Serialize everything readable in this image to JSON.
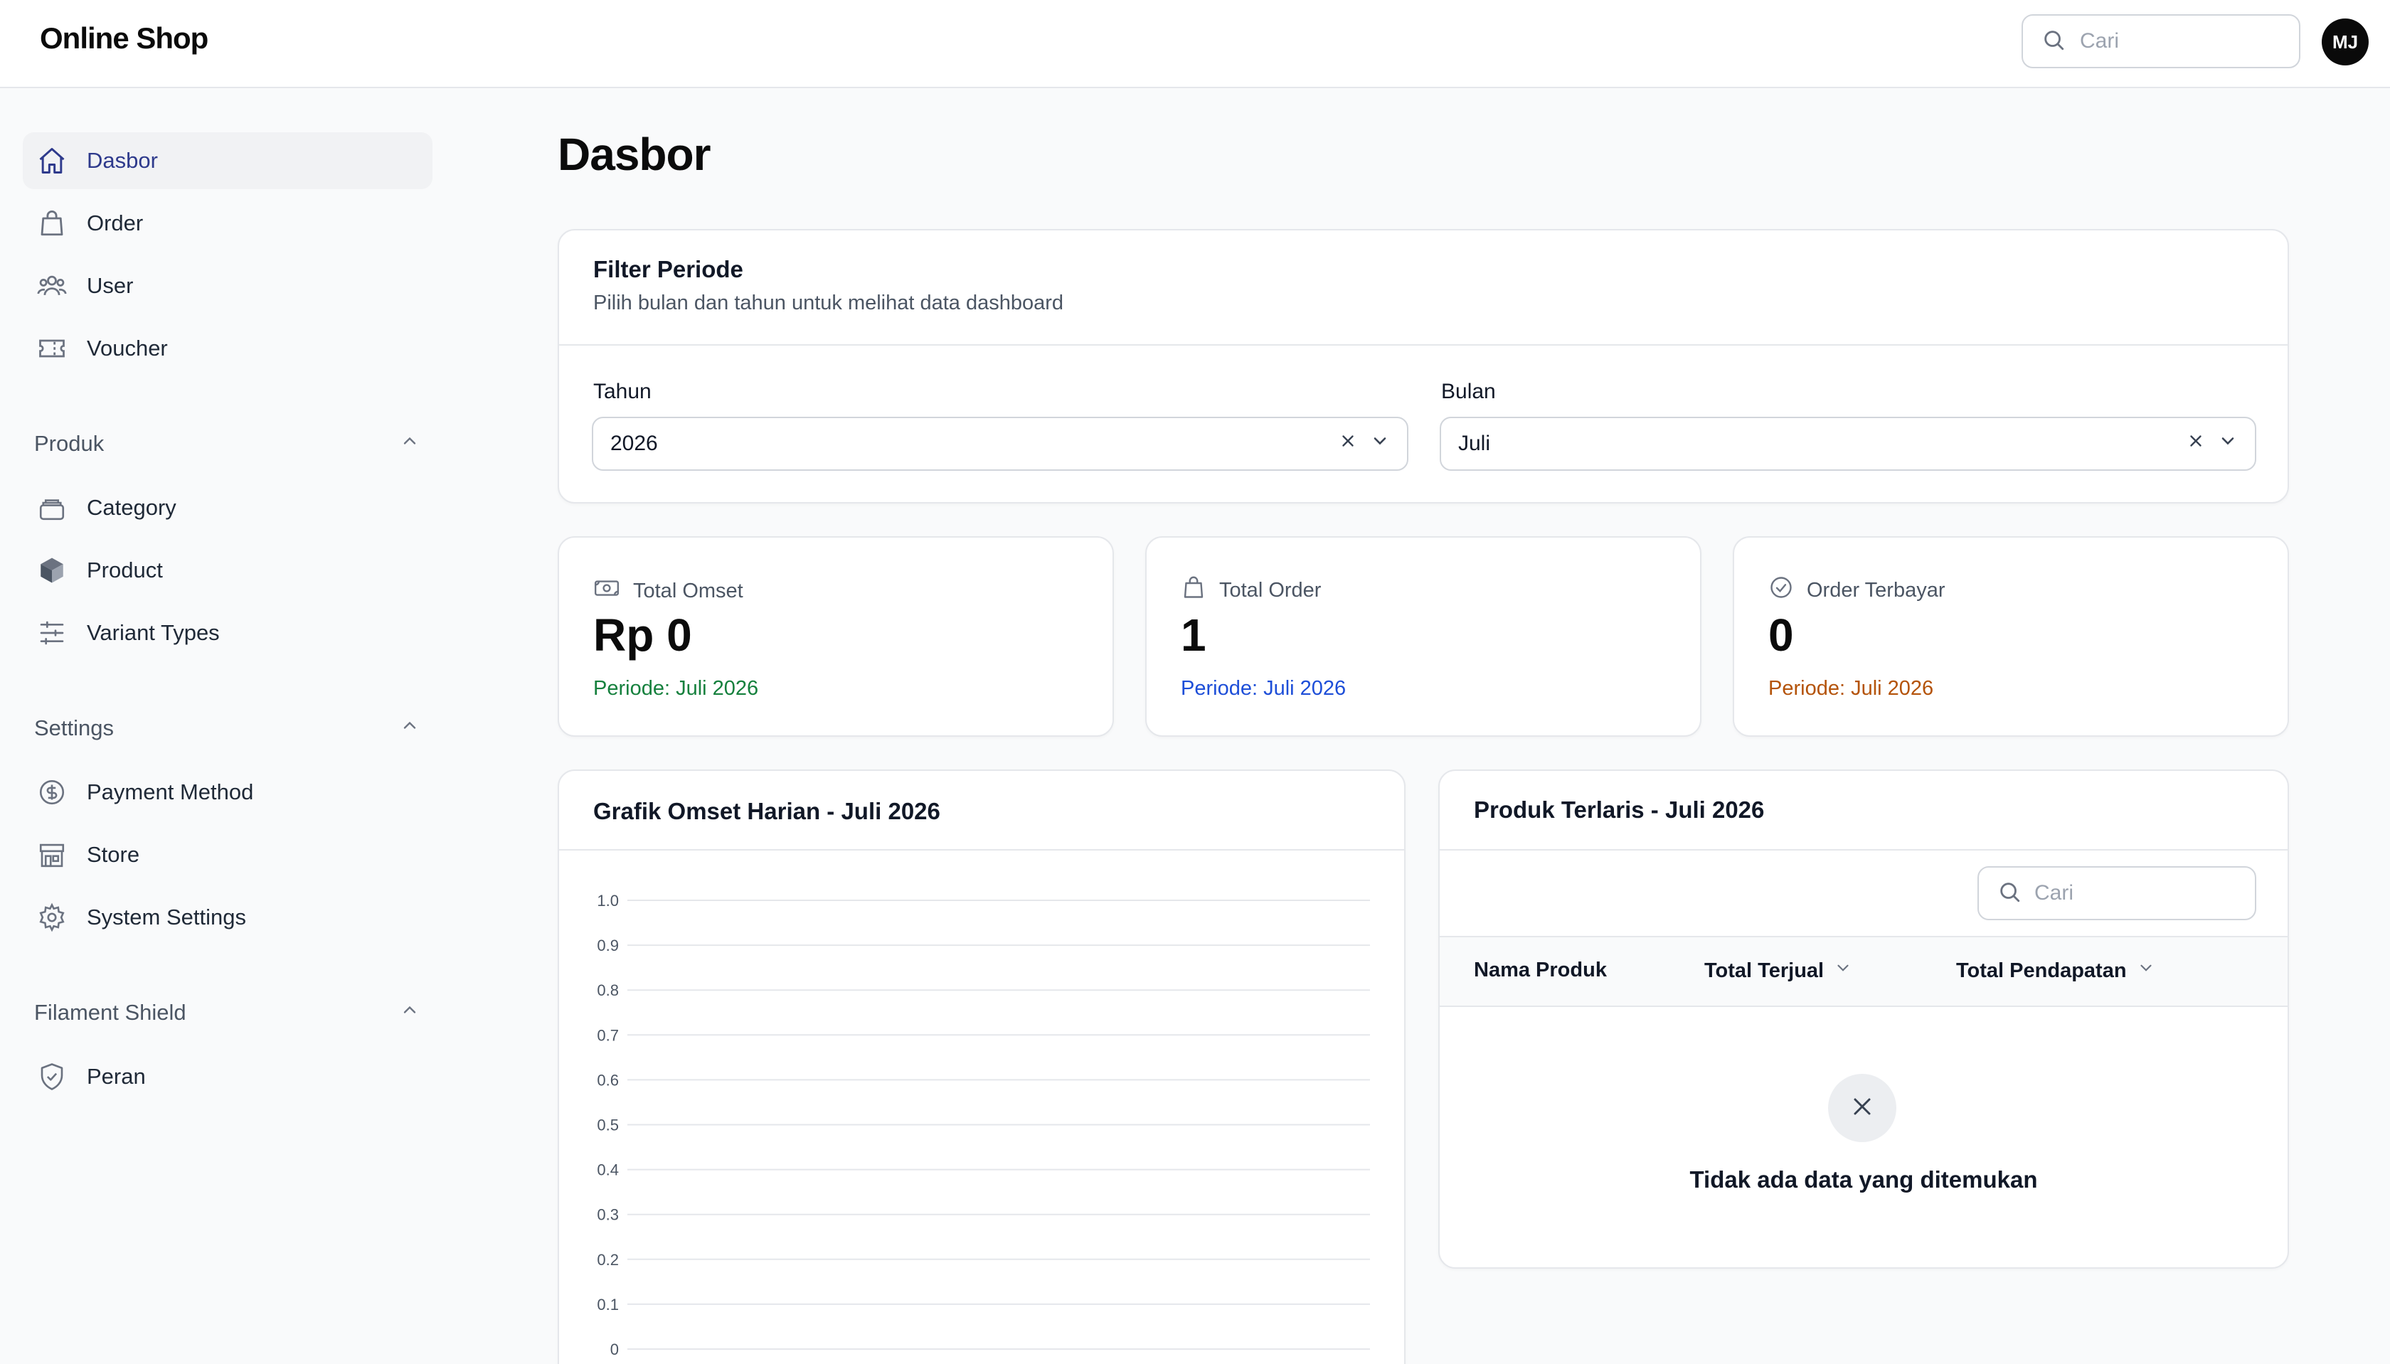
{
  "app": {
    "brand": "Online Shop",
    "search_placeholder": "Cari",
    "avatar_initials": "MJ"
  },
  "sidebar": {
    "top_items": [
      {
        "label": "Dasbor",
        "icon": "home-icon",
        "active": true
      },
      {
        "label": "Order",
        "icon": "shopping-bag-icon"
      },
      {
        "label": "User",
        "icon": "users-icon"
      },
      {
        "label": "Voucher",
        "icon": "ticket-icon"
      }
    ],
    "groups": [
      {
        "label": "Produk",
        "items": [
          {
            "label": "Category",
            "icon": "stack-icon"
          },
          {
            "label": "Product",
            "icon": "cube-icon"
          },
          {
            "label": "Variant Types",
            "icon": "sliders-icon"
          }
        ]
      },
      {
        "label": "Settings",
        "items": [
          {
            "label": "Payment Method",
            "icon": "dollar-circle-icon"
          },
          {
            "label": "Store",
            "icon": "storefront-icon"
          },
          {
            "label": "System Settings",
            "icon": "cog-icon"
          }
        ]
      },
      {
        "label": "Filament Shield",
        "items": [
          {
            "label": "Peran",
            "icon": "shield-check-icon"
          }
        ]
      }
    ]
  },
  "page": {
    "title": "Dasbor"
  },
  "filter": {
    "title": "Filter Periode",
    "subtitle": "Pilih bulan dan tahun untuk melihat data dashboard",
    "year_label": "Tahun",
    "year_value": "2026",
    "month_label": "Bulan",
    "month_value": "Juli"
  },
  "stats": [
    {
      "label": "Total Omset",
      "value": "Rp 0",
      "period": "Periode: Juli 2026",
      "color": "#15803d",
      "icon": "banknote-icon"
    },
    {
      "label": "Total Order",
      "value": "1",
      "period": "Periode: Juli 2026",
      "color": "#1d4ed8",
      "icon": "shopping-bag-icon"
    },
    {
      "label": "Order Terbayar",
      "value": "0",
      "period": "Periode: Juli 2026",
      "color": "#b45309",
      "icon": "check-circle-icon"
    }
  ],
  "chart": {
    "title": "Grafik Omset Harian - Juli 2026"
  },
  "chart_data": {
    "type": "line",
    "title": "Grafik Omset Harian - Juli 2026",
    "xlabel": "",
    "ylabel": "",
    "ylim": [
      0,
      1
    ],
    "yticks": [
      "1.0",
      "0.9",
      "0.8",
      "0.7",
      "0.6",
      "0.5",
      "0.4",
      "0.3",
      "0.2",
      "0.1",
      "0"
    ],
    "series": [],
    "grid": true
  },
  "top_products": {
    "title": "Produk Terlaris - Juli 2026",
    "search_placeholder": "Cari",
    "columns": [
      "Nama Produk",
      "Total Terjual",
      "Total Pendapatan"
    ],
    "rows": [],
    "empty_text": "Tidak ada data yang ditemukan"
  }
}
